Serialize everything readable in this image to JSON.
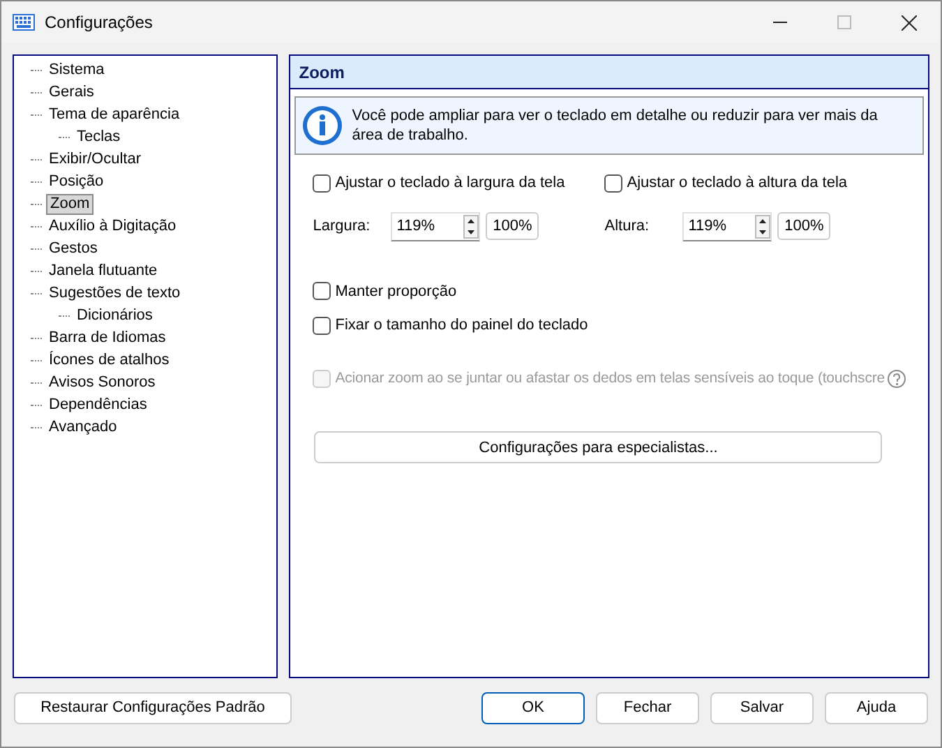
{
  "window": {
    "title": "Configurações"
  },
  "tree": [
    {
      "label": "Sistema",
      "selected": false
    },
    {
      "label": "Gerais",
      "selected": false
    },
    {
      "label": "Tema de aparência",
      "selected": false,
      "children": [
        {
          "label": "Teclas",
          "selected": false
        }
      ]
    },
    {
      "label": "Exibir/Ocultar",
      "selected": false
    },
    {
      "label": "Posição",
      "selected": false
    },
    {
      "label": "Zoom",
      "selected": true
    },
    {
      "label": "Auxílio à Digitação",
      "selected": false
    },
    {
      "label": "Gestos",
      "selected": false
    },
    {
      "label": "Janela flutuante",
      "selected": false
    },
    {
      "label": "Sugestões de texto",
      "selected": false,
      "children": [
        {
          "label": "Dicionários",
          "selected": false
        }
      ]
    },
    {
      "label": "Barra de Idiomas",
      "selected": false
    },
    {
      "label": "Ícones de atalhos",
      "selected": false
    },
    {
      "label": "Avisos Sonoros",
      "selected": false
    },
    {
      "label": "Dependências",
      "selected": false
    },
    {
      "label": "Avançado",
      "selected": false
    }
  ],
  "panel": {
    "title": "Zoom",
    "info": "Você pode ampliar para ver o teclado em detalhe ou reduzir para ver mais da área de trabalho.",
    "fit_checks": [
      {
        "label": "Ajustar o teclado à largura da tela",
        "checked": false
      },
      {
        "label": "Ajustar o teclado à altura da tela",
        "checked": false
      }
    ],
    "spinners": [
      {
        "label": "Largura:",
        "value": "119%",
        "reset": "100%"
      },
      {
        "label": "Altura:",
        "value": "119%",
        "reset": "100%"
      }
    ],
    "checks": [
      {
        "label": "Manter proporção",
        "checked": false
      },
      {
        "label": "Fixar o tamanho do painel do teclado",
        "checked": false
      }
    ],
    "touch_check": {
      "label": "Acionar zoom ao se juntar ou afastar os dedos em telas sensíveis ao toque (touchscre",
      "checked": false,
      "disabled": true
    },
    "expert_button": "Configurações para especialistas..."
  },
  "buttons": [
    {
      "label": "Restaurar Configurações Padrão",
      "kind": "left",
      "default": false
    },
    {
      "label": "OK",
      "kind": "right",
      "default": true
    },
    {
      "label": "Fechar",
      "kind": "right",
      "default": false
    },
    {
      "label": "Salvar",
      "kind": "right",
      "default": false
    },
    {
      "label": "Ajuda",
      "kind": "right",
      "default": false
    }
  ]
}
